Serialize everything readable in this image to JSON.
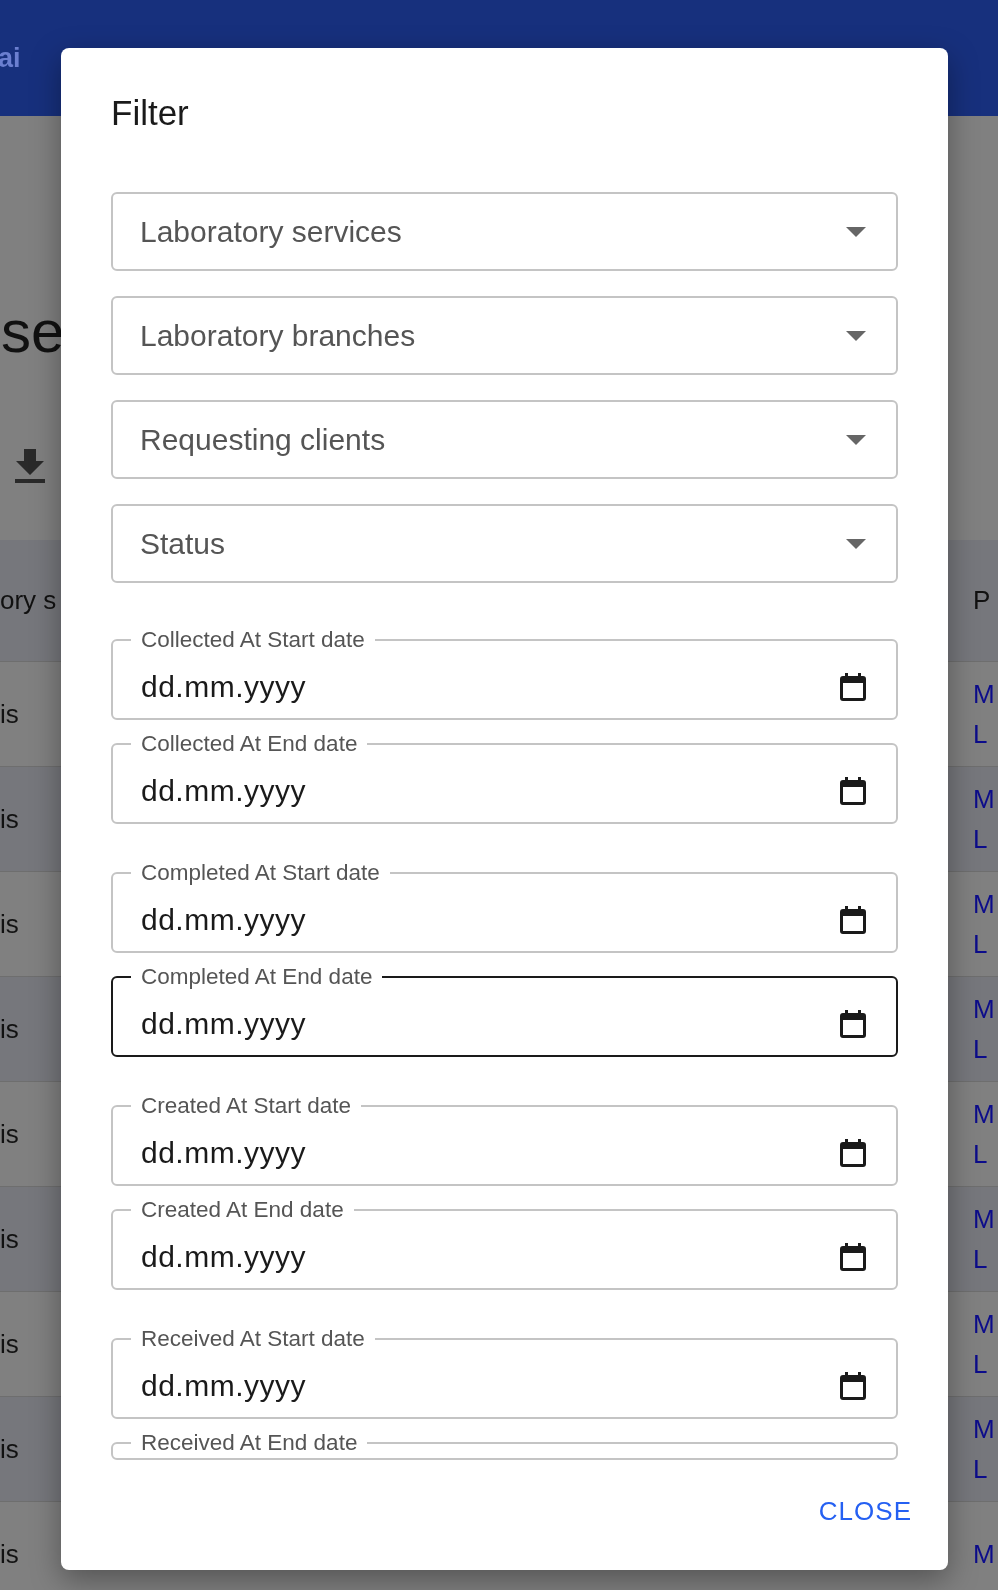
{
  "background": {
    "logo": "ai",
    "heading": "se",
    "table": {
      "header_left": "ory s",
      "header_right": "P",
      "rows": [
        {
          "left": "is",
          "right": [
            "M",
            "L"
          ]
        },
        {
          "left": "is",
          "right": [
            "M",
            "L"
          ]
        },
        {
          "left": "is",
          "right": [
            "M",
            "L"
          ]
        },
        {
          "left": "is",
          "right": [
            "M",
            "L"
          ]
        },
        {
          "left": "is",
          "right": [
            "M",
            "L"
          ]
        },
        {
          "left": "is",
          "right": [
            "M",
            "L"
          ]
        },
        {
          "left": "is",
          "right": [
            "M",
            "L"
          ]
        },
        {
          "left": "is",
          "right": [
            "M",
            "L"
          ]
        },
        {
          "left": "is",
          "right": [
            "M"
          ]
        }
      ]
    }
  },
  "dialog": {
    "title": "Filter",
    "selects": [
      {
        "label": "Laboratory services"
      },
      {
        "label": "Laboratory branches"
      },
      {
        "label": "Requesting clients"
      },
      {
        "label": "Status"
      }
    ],
    "date_groups": [
      [
        {
          "label": "Collected At Start date",
          "value": "dd.mm.yyyy",
          "focused": false
        },
        {
          "label": "Collected At End date",
          "value": "dd.mm.yyyy",
          "focused": false
        }
      ],
      [
        {
          "label": "Completed At Start date",
          "value": "dd.mm.yyyy",
          "focused": false
        },
        {
          "label": "Completed At End date",
          "value": "dd.mm.yyyy",
          "focused": true
        }
      ],
      [
        {
          "label": "Created At Start date",
          "value": "dd.mm.yyyy",
          "focused": false
        },
        {
          "label": "Created At End date",
          "value": "dd.mm.yyyy",
          "focused": false
        }
      ],
      [
        {
          "label": "Received At Start date",
          "value": "dd.mm.yyyy",
          "focused": false
        },
        {
          "label": "Received At End date",
          "focused": false
        }
      ]
    ],
    "buttons": [
      {
        "label": "CLOSE"
      }
    ]
  }
}
